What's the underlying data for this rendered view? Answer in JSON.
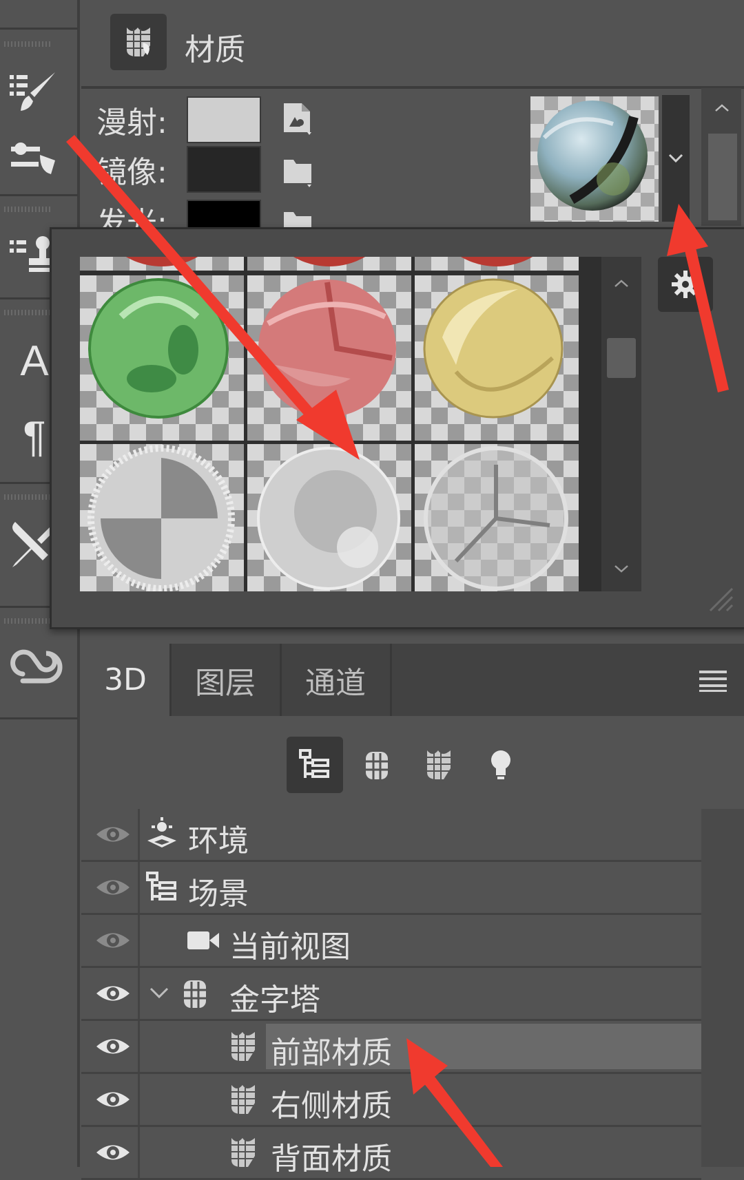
{
  "properties": {
    "title": "材质",
    "rows": [
      {
        "label": "漫射:",
        "color": "#cfcfcf"
      },
      {
        "label": "镜像:",
        "color": "#262626"
      },
      {
        "label": "发光:",
        "color": "#000000"
      }
    ]
  },
  "picker": {
    "materials": [
      {
        "name": "green-leaf-glass",
        "color": "#6fbf6a"
      },
      {
        "name": "red-glass",
        "color": "#d47a7a"
      },
      {
        "name": "gold-glass",
        "color": "#d9c77a"
      },
      {
        "name": "checker-glass",
        "color": "#bfbfbf"
      },
      {
        "name": "frosted-glass",
        "color": "#d5d5d5"
      },
      {
        "name": "clear-glass",
        "color": "#c9c9c9"
      }
    ]
  },
  "panel3d": {
    "tabs": [
      {
        "label": "3D",
        "active": true
      },
      {
        "label": "图层",
        "active": false
      },
      {
        "label": "通道",
        "active": false
      }
    ],
    "filters": [
      "scene-filter-icon",
      "mesh-filter-icon",
      "material-filter-icon",
      "light-filter-icon"
    ],
    "scene_items": [
      {
        "label": "环境",
        "icon": "environment-icon",
        "eye_dim": true
      },
      {
        "label": "场景",
        "icon": "scene-icon",
        "eye_dim": true
      },
      {
        "label": "当前视图",
        "icon": "camera-icon",
        "eye_dim": true
      },
      {
        "label": "金字塔",
        "icon": "mesh-icon",
        "eye_dim": false
      },
      {
        "label": "前部材质",
        "icon": "material-icon",
        "eye_dim": false,
        "selected": true
      },
      {
        "label": "右侧材质",
        "icon": "material-icon",
        "eye_dim": false
      },
      {
        "label": "背面材质",
        "icon": "material-icon",
        "eye_dim": false
      }
    ]
  },
  "colors": {
    "panel_bg": "#535353",
    "selection": "#6a6a6a",
    "annotation_arrow": "#f03a2e"
  }
}
